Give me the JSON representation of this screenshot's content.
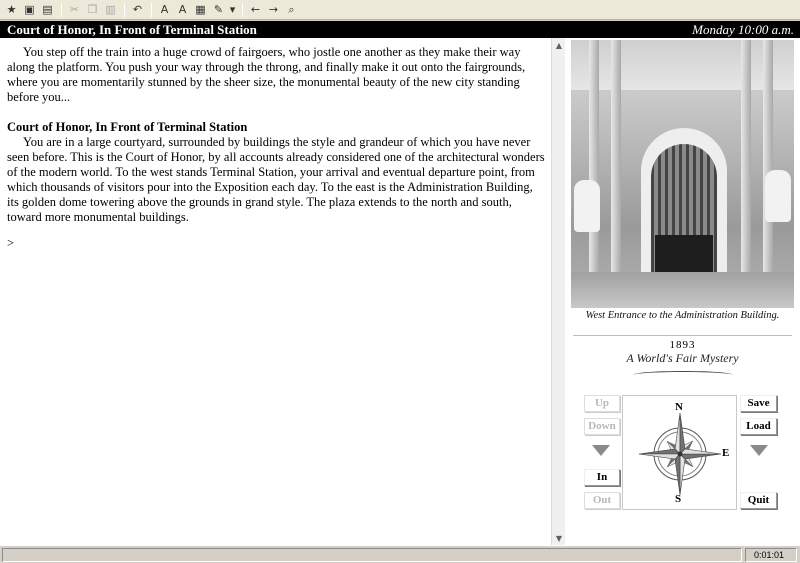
{
  "toolbar": {
    "icons": [
      "new-icon",
      "save-icon",
      "open-icon",
      "cut-icon",
      "copy-icon",
      "paste-icon",
      "undo-icon",
      "font-icon",
      "font-alt-icon",
      "story-info-icon",
      "options-icon",
      "back-icon",
      "forward-icon",
      "find-icon"
    ],
    "glyphs": {
      "new": "★",
      "save": "▣",
      "open": "▤",
      "cut": "✂",
      "copy": "❐",
      "paste": "▥",
      "undo": "↶",
      "font": "A",
      "font_alt": "A",
      "story": "▦",
      "options": "✎",
      "dropdown": "▾",
      "back": "←",
      "forward": "→",
      "find": "⌕"
    }
  },
  "status": {
    "location": "Court of Honor, In Front of Terminal Station",
    "time": "Monday 10:00 a.m."
  },
  "transcript": {
    "intro": "You step off the train into a huge crowd of fairgoers, who jostle one another as they make their way along the platform. You push your way through the throng, and finally make it out onto the fairgrounds, where you are momentarily stunned by the sheer size, the monumental beauty of the new city standing before you...",
    "room_title": "Court of Honor, In Front of Terminal Station",
    "room_desc": "You are in a large courtyard, surrounded by buildings the style and grandeur of which you have never seen before. This is the Court of Honor, by all accounts already considered one of the architectural wonders of the modern world. To the west stands Terminal Station, your arrival and eventual departure point, from which thousands of visitors pour into the Exposition each day. To the east is the Administration Building, its golden dome towering above the grounds in grand style. The plaza extends to the north and south, toward more monumental buildings.",
    "prompt": ">"
  },
  "scrollbar": {
    "up": "▲",
    "down": "▼"
  },
  "sidebar": {
    "caption": "West Entrance to the Administration Building.",
    "year": "1893",
    "logo": "A World's Fair Mystery"
  },
  "nav": {
    "up": "Up",
    "down": "Down",
    "in": "In",
    "out": "Out",
    "save": "Save",
    "load": "Load",
    "quit": "Quit",
    "north": "N",
    "south": "S",
    "east": "E"
  },
  "statusbar": {
    "elapsed": "0:01:01"
  },
  "colors": {
    "status_bar_bg": "#000000",
    "compass_light": "#e0e0e0",
    "compass_dark": "#707070"
  }
}
